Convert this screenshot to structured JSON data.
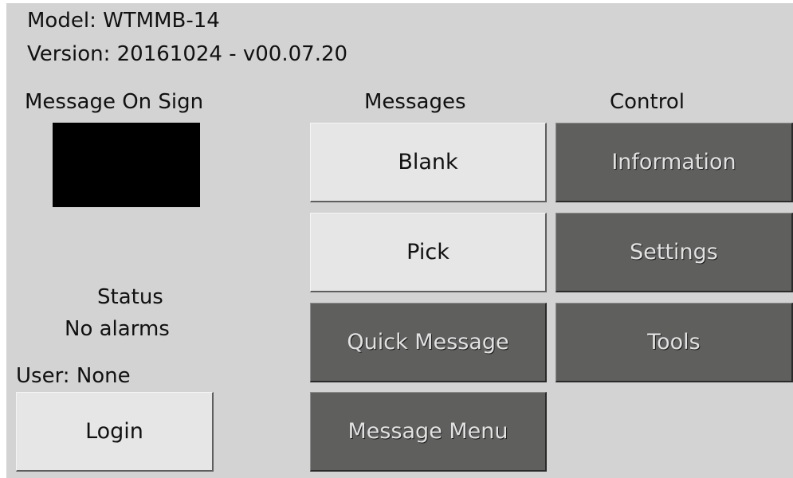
{
  "header": {
    "model": "Model: WTMMB-14",
    "version": "Version: 20161024 - v00.07.20"
  },
  "sign": {
    "label": "Message On Sign"
  },
  "status": {
    "label": "Status",
    "value": "No alarms"
  },
  "user": {
    "label": "User: None",
    "login_label": "Login"
  },
  "messages": {
    "heading": "Messages",
    "buttons": [
      "Blank",
      "Pick",
      "Quick Message",
      "Message Menu"
    ]
  },
  "control": {
    "heading": "Control",
    "buttons": [
      "Information",
      "Settings",
      "Tools"
    ]
  },
  "colors": {
    "background": "#d3d3d3",
    "light_button": "#e6e6e6",
    "dark_button": "#5f605e",
    "sign_display": "#000000"
  }
}
